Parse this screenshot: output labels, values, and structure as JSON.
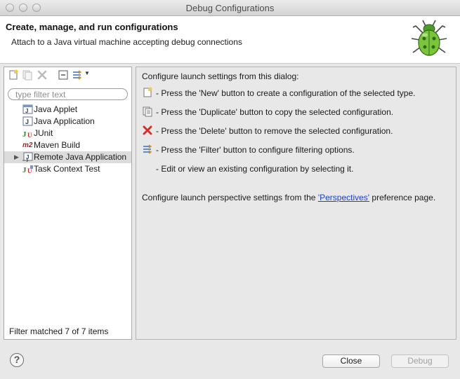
{
  "window": {
    "title": "Debug Configurations"
  },
  "header": {
    "title": "Create, manage, and run configurations",
    "subtitle": "Attach to a Java virtual machine accepting debug connections"
  },
  "left": {
    "filter_placeholder": "type filter text",
    "items": [
      {
        "label": "Java Applet",
        "icon": "java-applet-icon"
      },
      {
        "label": "Java Application",
        "icon": "java-application-icon"
      },
      {
        "label": "JUnit",
        "icon": "junit-icon"
      },
      {
        "label": "Maven Build",
        "icon": "maven-m2-icon",
        "icon_text": "m2"
      },
      {
        "label": "Remote Java Application",
        "icon": "remote-java-icon",
        "selected": true
      },
      {
        "label": "Task Context Test",
        "icon": "task-context-test-icon"
      }
    ],
    "status": "Filter matched 7 of 7 items"
  },
  "right": {
    "intro": "Configure launch settings from this dialog:",
    "hints": [
      {
        "icon": "new-config-icon",
        "text": "- Press the 'New' button to create a configuration of the selected type."
      },
      {
        "icon": "duplicate-icon",
        "text": "- Press the 'Duplicate' button to copy the selected configuration."
      },
      {
        "icon": "delete-icon",
        "text": "- Press the 'Delete' button to remove the selected configuration."
      },
      {
        "icon": "filter-icon",
        "text": "- Press the 'Filter' button to configure filtering options."
      },
      {
        "icon": "",
        "text": "- Edit or view an existing configuration by selecting it."
      }
    ],
    "perspective_prefix": "Configure launch perspective settings from the ",
    "perspective_link": "'Perspectives'",
    "perspective_suffix": " preference page."
  },
  "footer": {
    "help": "?",
    "close_label": "Close",
    "debug_label": "Debug"
  },
  "colors": {
    "link": "#1a3fd4",
    "selection": "#dcdcdc",
    "delete": "#d32f2f",
    "bug": "#6fbf3a"
  }
}
